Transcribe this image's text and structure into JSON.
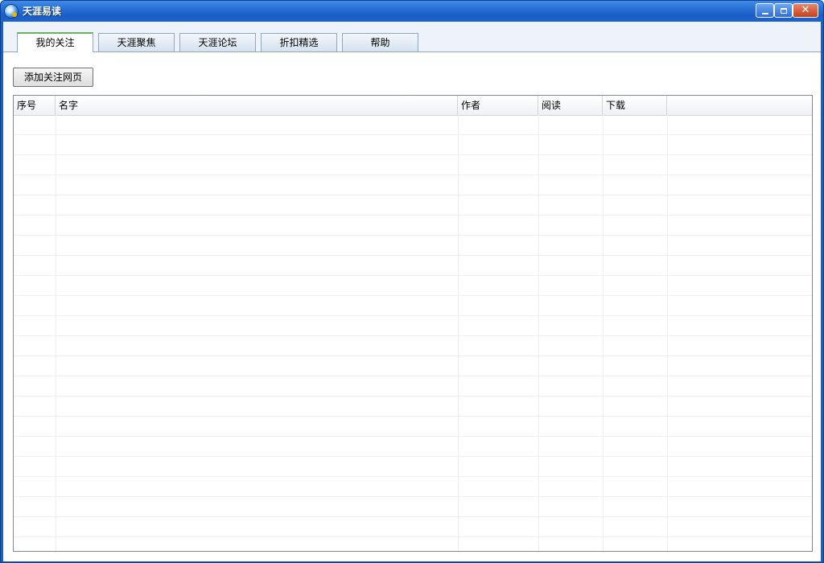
{
  "window": {
    "title": "天涯易读"
  },
  "tabs": [
    {
      "label": "我的关注",
      "active": true
    },
    {
      "label": "天涯聚焦",
      "active": false
    },
    {
      "label": "天涯论坛",
      "active": false
    },
    {
      "label": "折扣精选",
      "active": false
    },
    {
      "label": "帮助",
      "active": false
    }
  ],
  "toolbar": {
    "add_button_label": "添加关注网页"
  },
  "table": {
    "columns": [
      "序号",
      "名字",
      "作者",
      "阅读",
      "下载"
    ],
    "rows": []
  },
  "colors": {
    "titlebar": "#2a72d8",
    "active_tab_accent": "#6bb35a",
    "close_button": "#c3401f"
  },
  "icons": {
    "app": "tianya-reader-icon",
    "minimize": "minimize-icon",
    "maximize": "maximize-icon",
    "close": "close-icon"
  }
}
